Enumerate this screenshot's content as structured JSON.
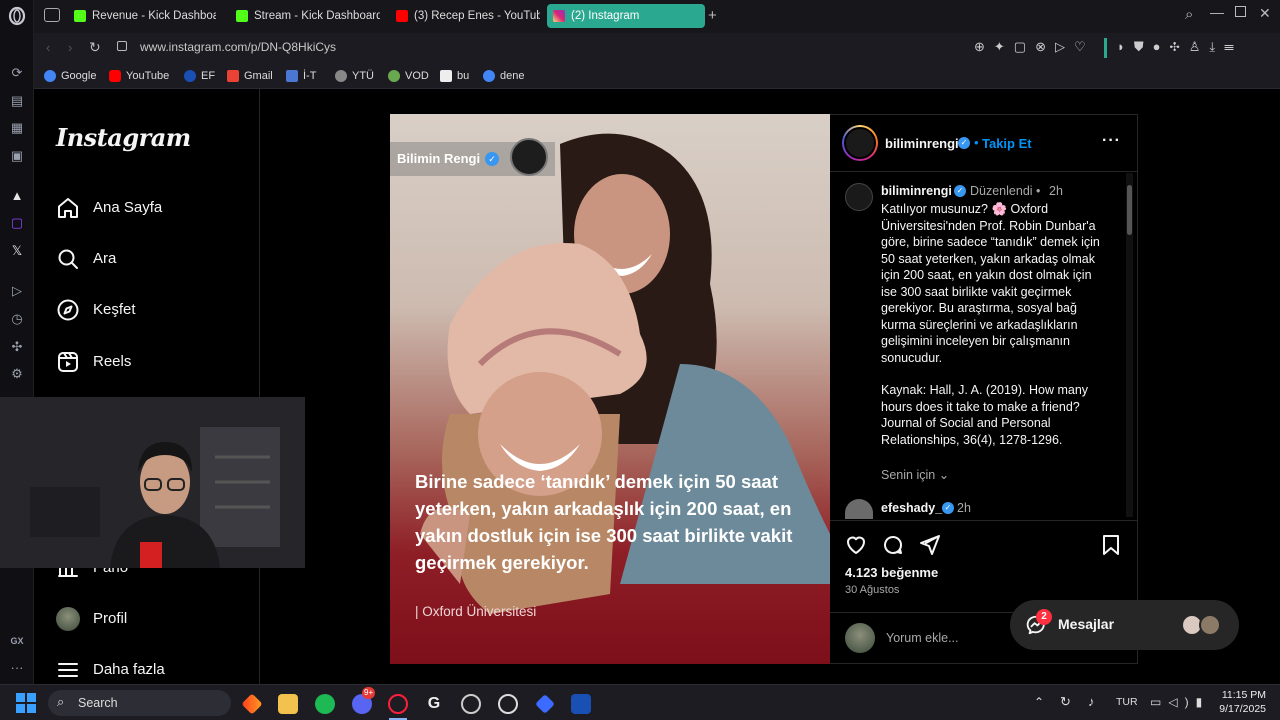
{
  "browser": {
    "tabs": [
      {
        "label": "Revenue - Kick Dashboard",
        "color": "#53fc18"
      },
      {
        "label": "Stream - Kick Dashboard",
        "color": "#53fc18"
      },
      {
        "label": "(3) Recep Enes - YouTube",
        "color": "#ff0000"
      },
      {
        "label": "(2) Instagram",
        "color": "#e1306c"
      }
    ],
    "url": "www.instagram.com/p/DN-Q8HkiCys",
    "bookmarks": [
      {
        "label": "Google",
        "color": "#4285f4"
      },
      {
        "label": "YouTube",
        "color": "#ff0000"
      },
      {
        "label": "EF",
        "color": "#1a4fb3"
      },
      {
        "label": "Gmail",
        "color": "#ea4335"
      },
      {
        "label": "İ-T",
        "color": "#4a77d4"
      },
      {
        "label": "YTÜ",
        "color": "#888888"
      },
      {
        "label": "VOD",
        "color": "#6aa84f"
      },
      {
        "label": "bu",
        "color": "#eeeeee"
      },
      {
        "label": "dene",
        "color": "#4285f4"
      }
    ]
  },
  "instagram": {
    "logo": "Instagram",
    "nav": {
      "home": "Ana Sayfa",
      "search": "Ara",
      "explore": "Keşfet",
      "reels": "Reels",
      "dashboard": "Pano",
      "profile": "Profil",
      "more": "Daha fazla"
    }
  },
  "post": {
    "image_account": "Bilimin Rengi",
    "image_headline": "Birine sadece ‘tanıdık’ demek için 50 saat yeterken, yakın arkadaşlık için 200 saat, en yakın dostluk için ise 300 saat birlikte vakit geçirmek gerekiyor.",
    "image_source": "| Oxford Üniversitesi",
    "header_username": "biliminrengi",
    "follow": "Takip Et",
    "caption_username": "biliminrengi",
    "edited": "Düzenlendi",
    "caption_time": "2h",
    "caption": "Katılıyor musunuz? 🌸 Oxford Üniversitesi'nden Prof. Robin Dunbar'a göre, birine sadece “tanıdık” demek için 50 saat yeterken, yakın arkadaş olmak için 200 saat, en yakın dost olmak için ise 300 saat birlikte vakit geçirmek gerekiyor. Bu araştırma, sosyal bağ kurma süreçlerini ve arkadaşlıkların gelişimini inceleyen bir çalışmanın sonucudur.",
    "source_ref": "Kaynak: Hall, J. A. (2019). How many hours does it take to make a friend? Journal of Social and Personal Relationships, 36(4), 1278-1296.",
    "for_you": "Senin için",
    "comment_user": "efeshady_",
    "comment_time": "2h",
    "likes": "4.123 beğenme",
    "date": "30 Ağustos",
    "comment_placeholder": "Yorum ekle..."
  },
  "messages": {
    "label": "Mesajlar",
    "badge": "2"
  },
  "taskbar": {
    "search": "Search",
    "lang": "TUR",
    "time": "11:15 PM",
    "date": "9/17/2025",
    "discord_badge": "9+"
  }
}
